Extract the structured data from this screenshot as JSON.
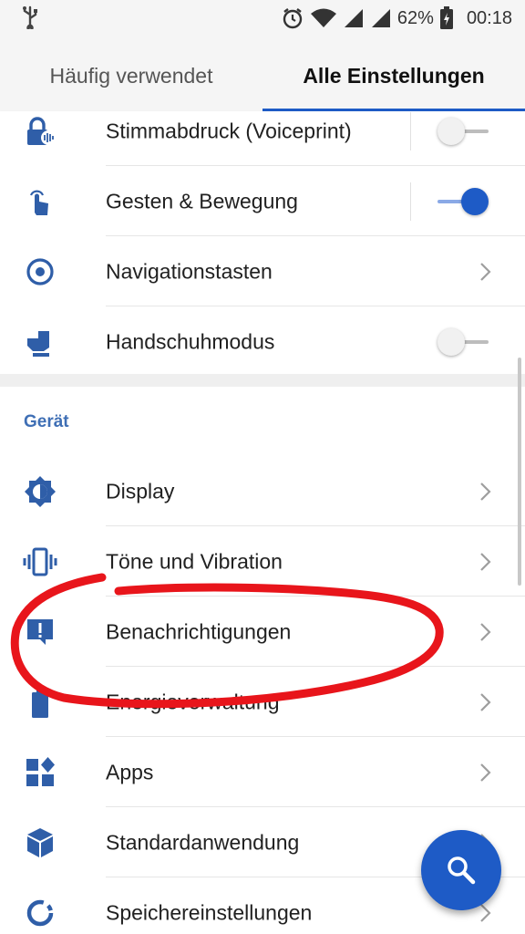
{
  "statusbar": {
    "battery": "62%",
    "time": "00:18",
    "icons": [
      "usb-icon",
      "alarm-icon",
      "wifi-icon",
      "signal-icon",
      "signal-icon",
      "battery-charging-icon"
    ]
  },
  "tabs": [
    {
      "label": "Häufig verwendet",
      "active": false
    },
    {
      "label": "Alle Einstellungen",
      "active": true
    }
  ],
  "top_items": [
    {
      "label": "Stimmabdruck (Voiceprint)",
      "icon": "voiceprint-lock-icon",
      "control": "toggle",
      "state": "off"
    },
    {
      "label": "Gesten & Bewegung",
      "icon": "gesture-hand-icon",
      "control": "toggle",
      "state": "on"
    },
    {
      "label": "Navigationstasten",
      "icon": "navigation-circle-icon",
      "control": "chevron"
    },
    {
      "label": "Handschuhmodus",
      "icon": "glove-icon",
      "control": "toggle",
      "state": "off"
    }
  ],
  "section": {
    "title": "Gerät"
  },
  "device_items": [
    {
      "label": "Display",
      "icon": "display-brightness-icon"
    },
    {
      "label": "Töne und Vibration",
      "icon": "vibration-icon"
    },
    {
      "label": "Benachrichtigungen",
      "icon": "notification-alert-icon"
    },
    {
      "label": "Energieverwaltung",
      "icon": "battery-icon"
    },
    {
      "label": "Apps",
      "icon": "apps-grid-icon"
    },
    {
      "label": "Standardanwendung",
      "icon": "cube-icon"
    },
    {
      "label": "Speichereinstellungen",
      "icon": "storage-ring-icon"
    }
  ],
  "fab": {
    "icon": "search-icon"
  },
  "colors": {
    "accent": "#1e5bc6",
    "icon": "#2f5ea8",
    "section_header": "#3f6fb5",
    "annotation": "#e8151b"
  }
}
